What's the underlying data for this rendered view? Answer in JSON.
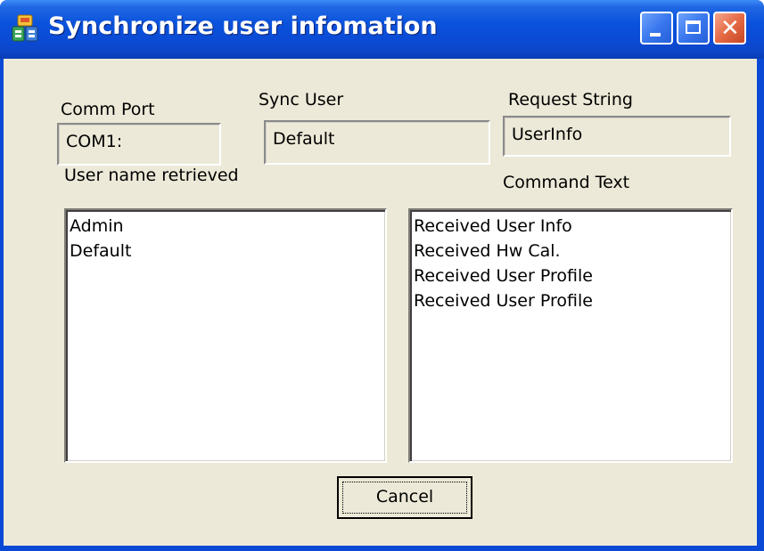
{
  "window": {
    "title": "Synchronize user infomation",
    "controls": {
      "minimize": "minimize",
      "maximize": "maximize",
      "close": "close"
    }
  },
  "fields": {
    "comm_port": {
      "label": "Comm Port",
      "value": "COM1:"
    },
    "sync_user": {
      "label": "Sync User",
      "value": "Default"
    },
    "request_string": {
      "label": "Request String",
      "value": "UserInfo"
    }
  },
  "user_list": {
    "label": "User name retrieved",
    "items": [
      "Admin",
      "Default"
    ]
  },
  "command_list": {
    "label": "Command Text",
    "items": [
      "Received User Info",
      "Received Hw Cal.",
      "Received User Profile",
      "Received User Profile"
    ]
  },
  "buttons": {
    "cancel": "Cancel"
  },
  "icons": {
    "app": "users-sync-icon"
  },
  "colors": {
    "titlebar": "#0a52dc",
    "client_bg": "#ece9d8",
    "close_button": "#e56a45"
  }
}
